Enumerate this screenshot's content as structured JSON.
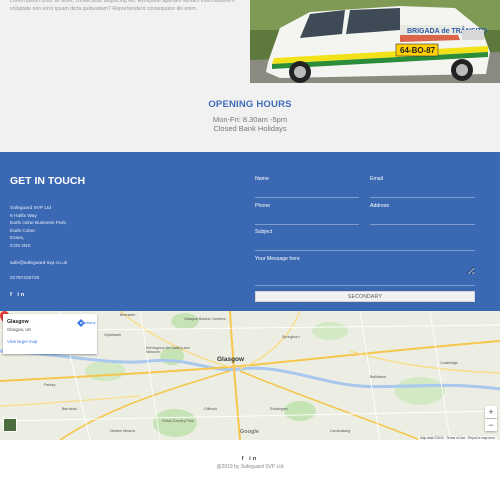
{
  "intro": {
    "text": "Lorem ipsum dolor sit amet, consectetur adipiscing elit. Excepteur aperiam veniam exercitationem voluptate non error ipsam dicta quibusdam? Reprehenderit consequatur illo enim."
  },
  "hours": {
    "title": "OPENING HOURS",
    "line1": "Mon-Fri: 8.30am -5pm",
    "line2": "Closed Bank Holidays"
  },
  "contact": {
    "heading": "GET IN TOUCH",
    "address": [
      "Safeguard SVP Ltd",
      "8 Halfix Way",
      "Earls colne Business Park,",
      "Earls Colne.",
      "Essex,",
      "CO6 2NS"
    ],
    "email": "safe@safeguard-svp.co.uk",
    "phone": "01787220720",
    "social": "f  in"
  },
  "form": {
    "name_label": "Name",
    "email_label": "Email",
    "phone_label": "Phone",
    "address_label": "Address",
    "subject_label": "Subject",
    "message_label": "Your Message here",
    "submit_label": "SECONDARY"
  },
  "map": {
    "card_title": "Glasgow",
    "card_subtitle": "Glasgow, UK",
    "directions_label": "Directions",
    "larger_map_label": "View larger map",
    "city_label": "Glasgow",
    "labels": {
      "botanic": "Glasgow Botanic Gardens",
      "kelvingrove": "Kelvingrove Art Gallery and Museum",
      "paisley": "Paisley",
      "pollok": "Pollok Country Park",
      "coatbridge": "Coatbridge",
      "cambuslang": "Cambuslang",
      "bearsden": "Bearsden",
      "clydebank": "Clydebank",
      "springburn": "Springburn",
      "baillieston": "Baillieston",
      "rutherglen": "Rutherglen",
      "barrhead": "Barrhead",
      "newton_mearns": "Newton Mearns",
      "giffnock": "Giffnock"
    },
    "zoom_in": "+",
    "zoom_out": "−",
    "google": "Google",
    "footer": "Map data ©2020 · Terms of Use · Report a map error"
  },
  "footer": {
    "social": "f  in",
    "copyright": "@2019 by Safeguard SVP Ltd"
  },
  "colors": {
    "accent_blue": "#3b68b3",
    "heading_blue": "#3f6bb8",
    "pin_red": "#e53935"
  }
}
